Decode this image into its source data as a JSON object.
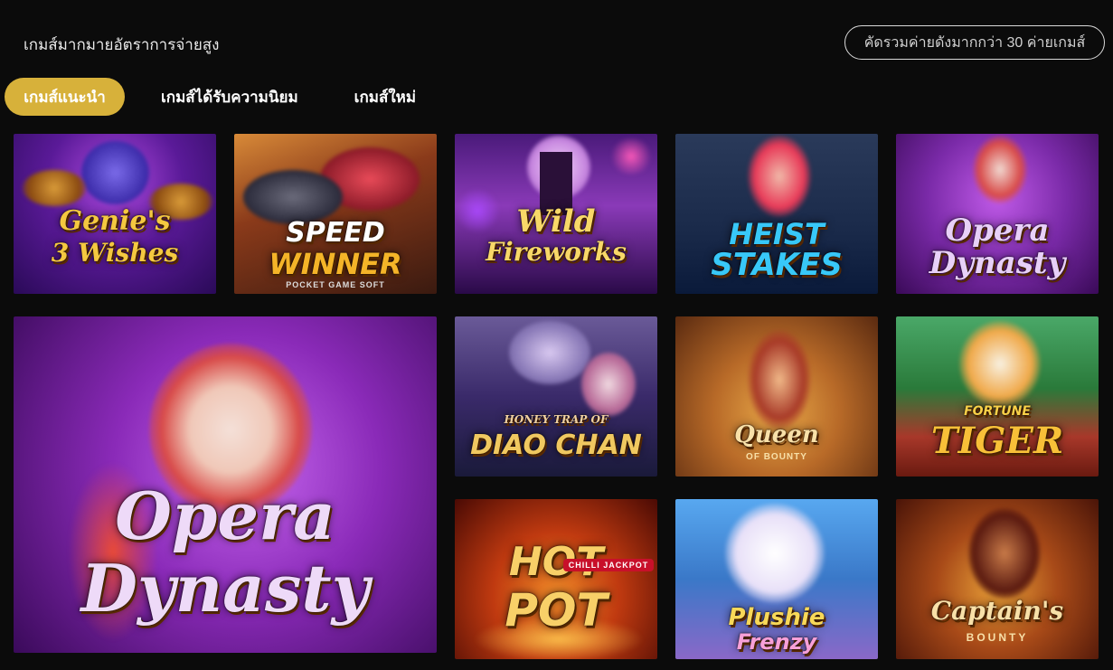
{
  "header": {
    "subtitle": "เกมส์มากมายอัตราการจ่ายสูง",
    "providers_button": "คัดรวมค่ายดังมากกว่า 30 ค่ายเกมส์"
  },
  "tabs": [
    {
      "label": "เกมส์แนะนำ",
      "active": true
    },
    {
      "label": "เกมส์ได้รับความนิยม",
      "active": false
    },
    {
      "label": "เกมส์ใหม่",
      "active": false
    }
  ],
  "games": [
    {
      "title": "Genie's 3 Wishes",
      "logo_line1": "Genie's",
      "logo_line2": "3 Wishes",
      "color": "#6a2aa8"
    },
    {
      "title": "Speed Winner",
      "logo_line1": "SPEED",
      "logo_line2": "WINNER",
      "tagline": "POCKET GAME SOFT",
      "color": "#7a2a18"
    },
    {
      "title": "Wild Fireworks",
      "logo_line1": "Wild",
      "logo_line2": "Fireworks",
      "color": "#5a2a8a"
    },
    {
      "title": "Heist Stakes",
      "logo_line1": "HEIST",
      "logo_line2": "STAKES",
      "color": "#1a3a6a"
    },
    {
      "title": "Opera Dynasty",
      "logo_line1": "Opera",
      "logo_line2": "Dynasty",
      "color": "#8a2ab8"
    },
    {
      "title": "Opera Dynasty",
      "logo_line1": "Opera",
      "logo_line2": "Dynasty",
      "color": "#8a2ab8"
    },
    {
      "title": "Honey Trap of Diao Chan",
      "logo_line1": "HONEY TRAP OF",
      "logo_line2": "DIAO CHAN",
      "color": "#3a2a5a"
    },
    {
      "title": "Queen of Bounty",
      "logo_line1": "Queen",
      "logo_line2": "OF BOUNTY",
      "color": "#8a4a18"
    },
    {
      "title": "Fortune Tiger",
      "logo_line1": "FORTUNE",
      "logo_line2": "TIGER",
      "color": "#2a7a3a"
    },
    {
      "title": "Hot Pot",
      "logo_line1": "HOT",
      "logo_line2": "POT",
      "tagline": "CHILLI JACKPOT",
      "color": "#8a1a08"
    },
    {
      "title": "Plushie Frenzy",
      "logo_line1": "Plushie",
      "logo_line2": "Frenzy",
      "color": "#3a6ab8"
    },
    {
      "title": "Captain's Bounty",
      "logo_line1": "Captain's",
      "logo_line2": "BOUNTY",
      "color": "#7a2a10"
    }
  ]
}
